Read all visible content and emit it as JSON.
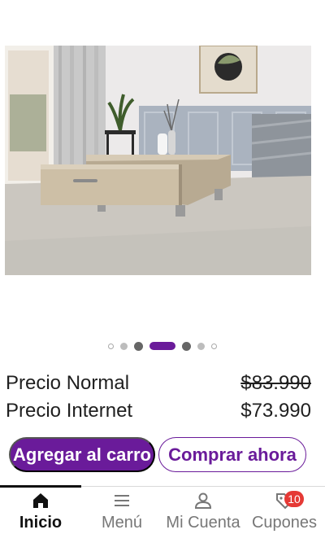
{
  "carousel": {
    "dot_count": 7,
    "active_index": 3
  },
  "prices": {
    "normal_label": "Precio Normal",
    "normal_value": "$83.990",
    "internet_label": "Precio Internet",
    "internet_value": "$73.990"
  },
  "actions": {
    "add_to_cart_label": "Agregar al carro",
    "buy_now_label": "Comprar ahora"
  },
  "nav": {
    "items": [
      {
        "label": "Inicio",
        "icon": "home-icon"
      },
      {
        "label": "Menú",
        "icon": "menu-icon"
      },
      {
        "label": "Mi Cuenta",
        "icon": "user-icon"
      },
      {
        "label": "Cupones",
        "icon": "coupon-icon"
      }
    ],
    "coupon_count": "10"
  },
  "colors": {
    "accent": "#6a1b9a",
    "badge": "#e53935"
  }
}
